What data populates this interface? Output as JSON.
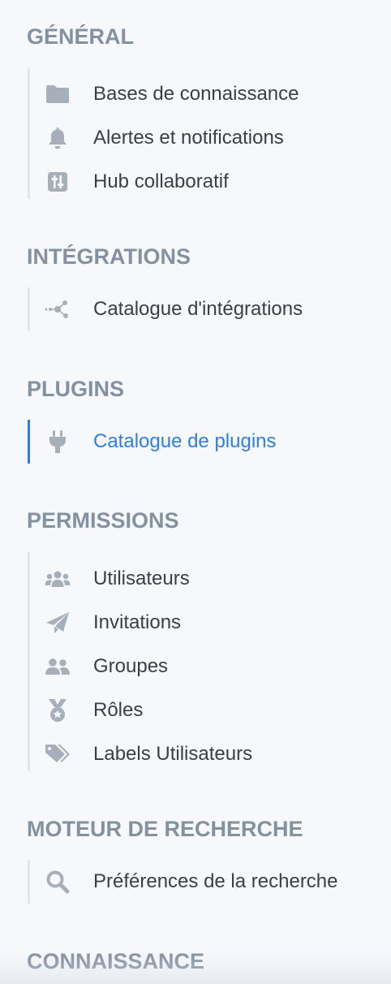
{
  "sections": [
    {
      "title": "GÉNÉRAL",
      "items": [
        {
          "label": "Bases de connaissance",
          "icon": "folder-icon"
        },
        {
          "label": "Alertes et notifications",
          "icon": "bell-icon"
        },
        {
          "label": "Hub collaboratif",
          "icon": "sliders-icon"
        }
      ]
    },
    {
      "title": "INTÉGRATIONS",
      "items": [
        {
          "label": "Catalogue d'intégrations",
          "icon": "network-icon"
        }
      ]
    },
    {
      "title": "PLUGINS",
      "items": [
        {
          "label": "Catalogue de plugins",
          "icon": "plug-icon",
          "selected": true
        }
      ]
    },
    {
      "title": "PERMISSIONS",
      "items": [
        {
          "label": "Utilisateurs",
          "icon": "users-icon"
        },
        {
          "label": "Invitations",
          "icon": "paper-plane-icon"
        },
        {
          "label": "Groupes",
          "icon": "group-icon"
        },
        {
          "label": "Rôles",
          "icon": "medal-icon"
        },
        {
          "label": "Labels Utilisateurs",
          "icon": "tags-icon"
        }
      ]
    },
    {
      "title": "MOTEUR DE RECHERCHE",
      "items": [
        {
          "label": "Préférences de la recherche",
          "icon": "search-icon"
        }
      ]
    },
    {
      "title": "CONNAISSANCE",
      "items": []
    }
  ],
  "colors": {
    "background": "#f6f8fc",
    "section_title": "#8391a0",
    "item_text": "#3b3f45",
    "icon": "#a7b0ba",
    "accent": "#2f7fe0"
  }
}
